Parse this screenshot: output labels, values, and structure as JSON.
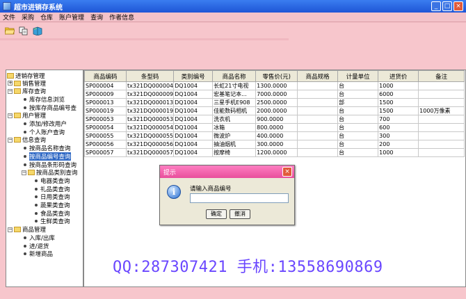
{
  "window": {
    "title": "超市进销存系统",
    "minimize": "_",
    "maximize": "□",
    "close": "×"
  },
  "menu": [
    "文件",
    "采购",
    "仓库",
    "账户管理",
    "查询",
    "作者信息"
  ],
  "toolbar": {
    "icons": [
      "open-folder-icon",
      "copy-icon",
      "book-icon"
    ]
  },
  "tree": {
    "root": "进销存管理",
    "items": [
      {
        "label": "销售管理",
        "type": "folder",
        "expander": "+"
      },
      {
        "label": "库存查询",
        "type": "folder",
        "expander": "−"
      },
      {
        "label": "库存信息浏览",
        "type": "leaf"
      },
      {
        "label": "按库存商品编号查",
        "type": "leaf"
      },
      {
        "label": "用户管理",
        "type": "folder",
        "expander": "−"
      },
      {
        "label": "添加/修改用户",
        "type": "leaf"
      },
      {
        "label": "个人账户查询",
        "type": "leaf"
      },
      {
        "label": "信息查询",
        "type": "folder",
        "expander": "−"
      },
      {
        "label": "按商品名称查询",
        "type": "leaf"
      },
      {
        "label": "按商品编号查询",
        "type": "leaf",
        "selected": true,
        "display": "按商品编号查询"
      },
      {
        "label": "按商品条形码查询",
        "type": "leaf"
      },
      {
        "label": "按商品类别查询",
        "type": "folder",
        "expander": "−"
      },
      {
        "label": "电器类查询",
        "type": "leaf"
      },
      {
        "label": "礼品类查询",
        "type": "leaf"
      },
      {
        "label": "日用类查询",
        "type": "leaf"
      },
      {
        "label": "蔬果类查询",
        "type": "leaf"
      },
      {
        "label": "食品类查询",
        "type": "leaf"
      },
      {
        "label": "生鲜类查询",
        "type": "leaf"
      },
      {
        "label": "商品管理",
        "type": "folder",
        "expander": "−"
      },
      {
        "label": "入库/出库",
        "type": "leaf"
      },
      {
        "label": "进/退货",
        "type": "leaf"
      },
      {
        "label": "新增商品",
        "type": "leaf"
      }
    ]
  },
  "grid": {
    "columns": [
      "商品编码",
      "条型码",
      "类别编号",
      "商品名称",
      "零售价(元)",
      "商品规格",
      "计量单位",
      "进货价",
      "备注"
    ],
    "rows": [
      [
        "SP000004",
        "tx321DQ000004",
        "DQ1004",
        "长虹21寸电视",
        "1300.0000",
        "",
        "台",
        "1000",
        ""
      ],
      [
        "SP000009",
        "tx321DQ000009",
        "DQ1004",
        "宏基笔记本...",
        "7000.0000",
        "",
        "台",
        "6000",
        ""
      ],
      [
        "SP000013",
        "tx321DQ000013",
        "DQ1004",
        "三星手机E908",
        "2500.0000",
        "",
        "部",
        "1500",
        ""
      ],
      [
        "SP000019",
        "tx321DQ000019",
        "DQ1004",
        "佳能数码相机",
        "2000.0000",
        "",
        "台",
        "1500",
        "1000万像素"
      ],
      [
        "SP000053",
        "tx321DQ000053",
        "DQ1004",
        "洗衣机",
        "900.0000",
        "",
        "台",
        "700",
        ""
      ],
      [
        "SP000054",
        "tx321DQ000054",
        "DQ1004",
        "冰箱",
        "800.0000",
        "",
        "台",
        "600",
        ""
      ],
      [
        "SP000055",
        "tx321DQ000055",
        "DQ1004",
        "微波炉",
        "400.0000",
        "",
        "台",
        "300",
        ""
      ],
      [
        "SP000056",
        "tx321DQ000056",
        "DQ1004",
        "抽油烟机",
        "300.0000",
        "",
        "台",
        "200",
        ""
      ],
      [
        "SP000057",
        "tx321DQ000057",
        "DQ1004",
        "按摩椅",
        "1200.0000",
        "",
        "台",
        "1000",
        ""
      ]
    ]
  },
  "dialog": {
    "title": "提示",
    "prompt": "请输入商品编号",
    "input_value": "",
    "ok": "确定",
    "cancel": "撤消",
    "info_glyph": "i",
    "close": "×"
  },
  "overlay": "QQ:287307421 手机:13558690869"
}
